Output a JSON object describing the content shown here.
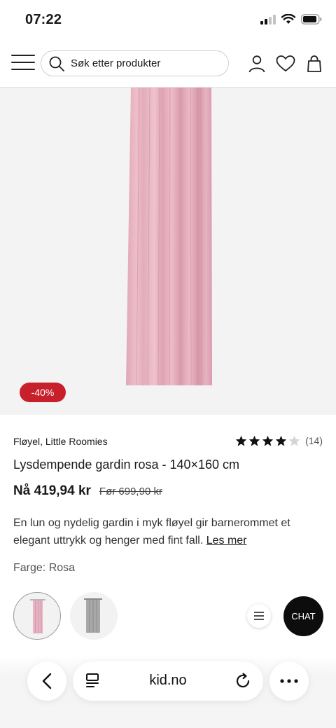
{
  "status_bar": {
    "time": "07:22"
  },
  "header": {
    "search": {
      "placeholder": "Søk etter produkter"
    }
  },
  "product": {
    "discount_badge": "-40%",
    "brand": "Fløyel, Little Roomies",
    "rating": {
      "stars": 4,
      "max_stars": 5,
      "count": "(14)"
    },
    "title": "Lysdempende gardin rosa - 140×160 cm",
    "price_now": "Nå 419,94 kr",
    "price_before": "Før 699,90 kr",
    "description": "En lun og nydelig gardin i myk fløyel gir barnerommet et elegant uttrykk og henger med fint fall.",
    "read_more": "Les mer",
    "color_label": "Farge:",
    "color_value": "Rosa",
    "swatches": [
      {
        "color": "#e8b3c2",
        "selected": true
      },
      {
        "color": "#a8a8a8",
        "selected": false
      }
    ]
  },
  "chat": {
    "label": "CHAT"
  },
  "browser": {
    "url": "kid.no"
  },
  "colors": {
    "accent_badge": "#c8202b",
    "curtain_pink": "#e9b7c5",
    "chat_bg": "#0d0d0d"
  }
}
